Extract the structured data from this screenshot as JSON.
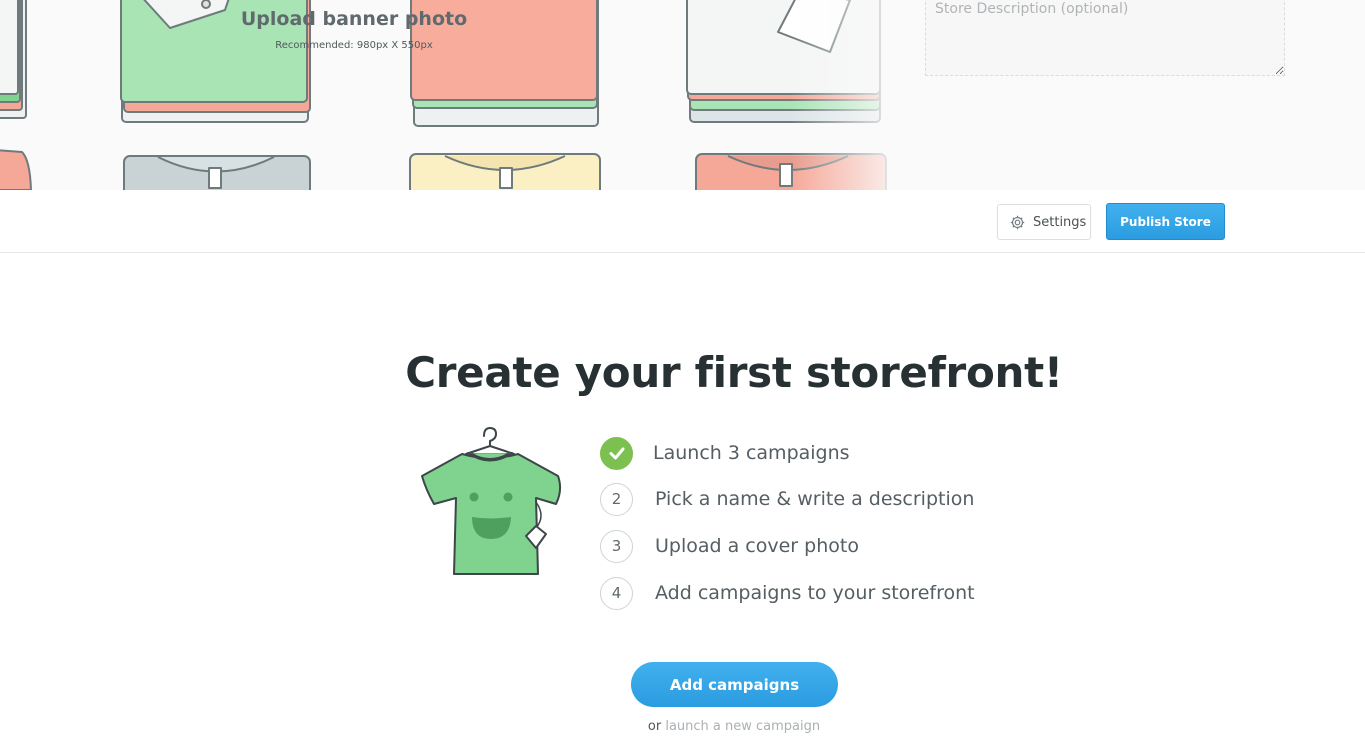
{
  "banner": {
    "upload_title": "Upload banner photo",
    "upload_hint": "Recommended: 980px X 550px",
    "description_placeholder": "Store Description (optional)"
  },
  "toolbar": {
    "settings_label": "Settings",
    "publish_label": "Publish Store"
  },
  "main": {
    "headline": "Create your first storefront!",
    "steps": [
      {
        "marker": "",
        "label": "Launch 3 campaigns",
        "done": true
      },
      {
        "marker": "2",
        "label": "Pick a name & write a description",
        "done": false
      },
      {
        "marker": "3",
        "label": "Upload a cover photo",
        "done": false
      },
      {
        "marker": "4",
        "label": "Add campaigns to your storefront",
        "done": false
      }
    ],
    "add_button": "Add campaigns",
    "or_text": "or",
    "launch_link": "launch a new campaign"
  },
  "colors": {
    "accent_blue": "#2a9de0",
    "check_green": "#7cc04f",
    "shirt_green": "#7fd38f",
    "shirt_salmon": "#f6a898",
    "shirt_cream": "#fbefc4",
    "shirt_gray": "#c9d3d6"
  },
  "icons": {
    "settings": "gear-icon",
    "step1": "checkmark-icon",
    "illustration": "tshirt-hanger-illustration"
  }
}
